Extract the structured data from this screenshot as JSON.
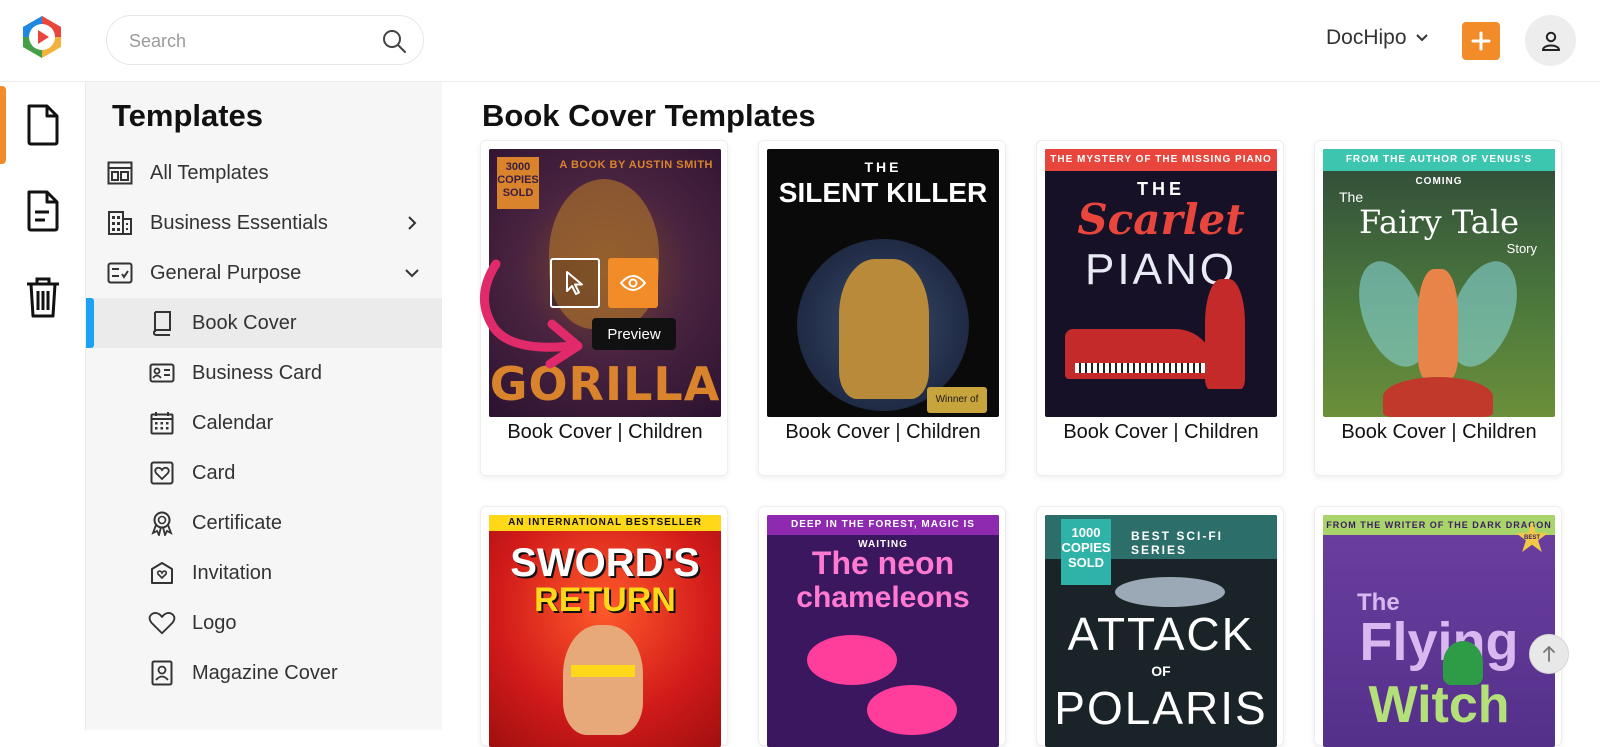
{
  "header": {
    "search_placeholder": "Search",
    "brand_label": "DocHipo",
    "accent_color": "#f28c28"
  },
  "rail": {
    "items": [
      {
        "icon": "document-icon",
        "active": true
      },
      {
        "icon": "document-lines-icon",
        "active": false
      },
      {
        "icon": "trash-icon",
        "active": false
      }
    ]
  },
  "sidebar": {
    "title": "Templates",
    "items": [
      {
        "label": "All Templates",
        "icon": "layout-icon"
      },
      {
        "label": "Business Essentials",
        "icon": "building-icon",
        "chevron": "right"
      },
      {
        "label": "General Purpose",
        "icon": "checklist-icon",
        "chevron": "down"
      },
      {
        "label": "Book Cover",
        "icon": "book-icon",
        "selected": true
      },
      {
        "label": "Business Card",
        "icon": "id-card-icon"
      },
      {
        "label": "Calendar",
        "icon": "calendar-icon"
      },
      {
        "label": "Card",
        "icon": "heart-card-icon"
      },
      {
        "label": "Certificate",
        "icon": "award-icon"
      },
      {
        "label": "Invitation",
        "icon": "invitation-icon"
      },
      {
        "label": "Logo",
        "icon": "heart-icon"
      },
      {
        "label": "Magazine Cover",
        "icon": "magazine-icon"
      }
    ],
    "selected_color": "#1da1f2"
  },
  "main": {
    "title": "Book Cover Templates",
    "tooltip": "Preview",
    "cards": [
      {
        "label": "Book Cover | Children",
        "top": "A BOOK BY AUSTIN SMITH",
        "badge": "3000 COPIES SOLD",
        "main": "GORILLA"
      },
      {
        "label": "Book Cover | Children",
        "top": "THE",
        "main": "SILENT KILLER",
        "badge": "Winner of"
      },
      {
        "label": "Book Cover | Children",
        "top": "THE MYSTERY OF THE MISSING PIANO",
        "main_a": "THE",
        "main_b": "Scarlet",
        "main_c": "PIANO"
      },
      {
        "label": "Book Cover | Children",
        "top": "FROM THE AUTHOR OF VENUS'S COMING",
        "main_a": "The",
        "main_b": "Fairy Tale",
        "main_c": "Story"
      },
      {
        "top": "AN INTERNATIONAL BESTSELLER",
        "main_a": "SWORD'S",
        "main_b": "RETURN"
      },
      {
        "top": "DEEP IN THE FOREST, MAGIC IS WAITING",
        "main_a": "The neon",
        "main_b": "chameleons"
      },
      {
        "badge": "1000 COPIES SOLD",
        "top": "BEST SCI-FI SERIES",
        "main_a": "ATTACK",
        "main_b": "OF",
        "main_c": "POLARIS"
      },
      {
        "top": "FROM THE WRITER OF THE DARK DRAGON",
        "badge": "BEST SELLER",
        "main_a": "The",
        "main_b": "Flying",
        "main_c": "Witch"
      }
    ]
  }
}
